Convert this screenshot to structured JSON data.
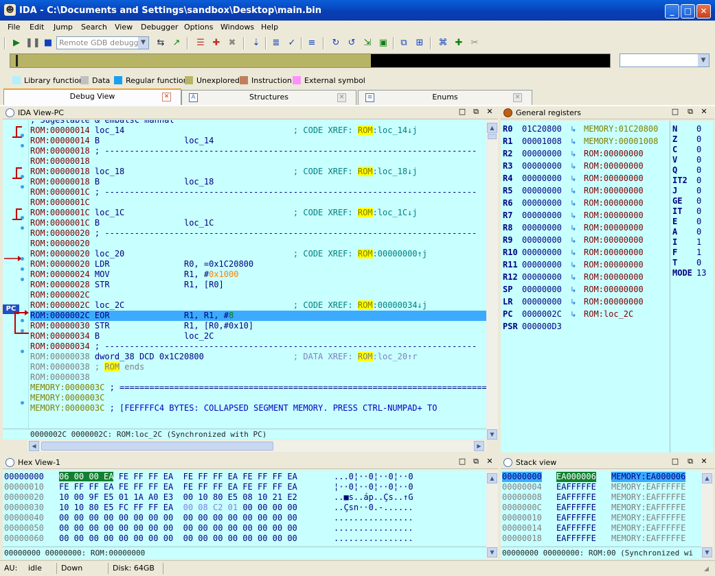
{
  "window": {
    "title": "IDA - C:\\Documents and Settings\\sandbox\\Desktop\\main.bin",
    "minimize": "_",
    "maximize": "□",
    "close": "✕"
  },
  "menu": [
    "File",
    "Edit",
    "Jump",
    "Search",
    "View",
    "Debugger",
    "Options",
    "Windows",
    "Help"
  ],
  "toolbar": {
    "debugger_select": "Remote GDB debugger"
  },
  "legend": [
    {
      "label": "Library function",
      "color": "#b0f0ff"
    },
    {
      "label": "Data",
      "color": "#c0c0c0"
    },
    {
      "label": "Regular function",
      "color": "#1aa0f0"
    },
    {
      "label": "Unexplored",
      "color": "#b8b466"
    },
    {
      "label": "Instruction",
      "color": "#c08060"
    },
    {
      "label": "External symbol",
      "color": "#ff90ff"
    }
  ],
  "tabs": [
    {
      "label": "Debug View",
      "active": true
    },
    {
      "label": "Structures"
    },
    {
      "label": "Enums"
    }
  ],
  "ida_view": {
    "title": "IDA View-PC",
    "lines": [
      [
        [
          "ROM:00000014 ",
          "#800000"
        ],
        [
          "loc_14",
          "#000080"
        ],
        [
          "                                  ; CODE XREF: ",
          "#008080"
        ],
        [
          "ROM",
          "#808000",
          "#ffff00"
        ],
        [
          ":loc_14↓j",
          "#008080"
        ]
      ],
      [
        [
          "ROM:00000014 ",
          "#800000"
        ],
        [
          "B                 ",
          "#000080"
        ],
        [
          "loc_14",
          "#000080"
        ]
      ],
      [
        [
          "ROM:00000018 ",
          "#800000"
        ],
        [
          "; ---------------------------------------------------------------------------",
          "#000080"
        ]
      ],
      [
        [
          "ROM:00000018",
          "#800000"
        ]
      ],
      [
        [
          "ROM:00000018 ",
          "#800000"
        ],
        [
          "loc_18",
          "#000080"
        ],
        [
          "                                  ; CODE XREF: ",
          "#008080"
        ],
        [
          "ROM",
          "#808000",
          "#ffff00"
        ],
        [
          ":loc_18↓j",
          "#008080"
        ]
      ],
      [
        [
          "ROM:00000018 ",
          "#800000"
        ],
        [
          "B                 ",
          "#000080"
        ],
        [
          "loc_18",
          "#000080"
        ]
      ],
      [
        [
          "ROM:0000001C ",
          "#800000"
        ],
        [
          "; ---------------------------------------------------------------------------",
          "#000080"
        ]
      ],
      [
        [
          "ROM:0000001C",
          "#800000"
        ]
      ],
      [
        [
          "ROM:0000001C ",
          "#800000"
        ],
        [
          "loc_1C",
          "#000080"
        ],
        [
          "                                  ; CODE XREF: ",
          "#008080"
        ],
        [
          "ROM",
          "#808000",
          "#ffff00"
        ],
        [
          ":loc_1C↓j",
          "#008080"
        ]
      ],
      [
        [
          "ROM:0000001C ",
          "#800000"
        ],
        [
          "B                 ",
          "#000080"
        ],
        [
          "loc_1C",
          "#000080"
        ]
      ],
      [
        [
          "ROM:00000020 ",
          "#800000"
        ],
        [
          "; ---------------------------------------------------------------------------",
          "#000080"
        ]
      ],
      [
        [
          "ROM:00000020",
          "#800000"
        ]
      ],
      [
        [
          "ROM:00000020 ",
          "#800000"
        ],
        [
          "loc_20",
          "#000080"
        ],
        [
          "                                  ; CODE XREF: ",
          "#008080"
        ],
        [
          "ROM",
          "#808000",
          "#ffff00"
        ],
        [
          ":00000000↑j",
          "#008080"
        ]
      ],
      [
        [
          "ROM:00000020 ",
          "#800000"
        ],
        [
          "LDR               ",
          "#000080"
        ],
        [
          "R0, =0x1C20800",
          "#000080"
        ]
      ],
      [
        [
          "ROM:00000024 ",
          "#800000"
        ],
        [
          "MOV               ",
          "#000080"
        ],
        [
          "R1, #",
          "#000080"
        ],
        [
          "0x1000",
          "#ff8000"
        ]
      ],
      [
        [
          "ROM:00000028 ",
          "#800000"
        ],
        [
          "STR               ",
          "#000080"
        ],
        [
          "R1, [R0]",
          "#000080"
        ]
      ],
      [
        [
          "ROM:0000002C",
          "#800000"
        ]
      ],
      [
        [
          "ROM:0000002C ",
          "#800000"
        ],
        [
          "loc_2C",
          "#000080"
        ],
        [
          "                                  ; CODE XREF: ",
          "#008080"
        ],
        [
          "ROM",
          "#808000",
          "#ffff00"
        ],
        [
          ":00000034↓j",
          "#008080"
        ]
      ],
      [
        [
          "ROM:0000002C ",
          "#000080"
        ],
        [
          "EOR               ",
          "#000080"
        ],
        [
          "R1, R1, #",
          "#000080"
        ],
        [
          "8",
          "#008000"
        ]
      ],
      [
        [
          "ROM:00000030 ",
          "#800000"
        ],
        [
          "STR               ",
          "#000080"
        ],
        [
          "R1, [R0,#0x10]",
          "#000080"
        ]
      ],
      [
        [
          "ROM:00000034 ",
          "#800000"
        ],
        [
          "B                 ",
          "#000080"
        ],
        [
          "loc_2C",
          "#000080"
        ]
      ],
      [
        [
          "ROM:00000034 ",
          "#800000"
        ],
        [
          "; ---------------------------------------------------------------------------",
          "#000080"
        ]
      ],
      [
        [
          "ROM:00000038 ",
          "#808080"
        ],
        [
          "dword_38 DCD 0x1C20800",
          "#000080"
        ],
        [
          "                  ; DATA XREF: ",
          "#8080c0"
        ],
        [
          "ROM",
          "#808080",
          "#ffff00"
        ],
        [
          ":loc_20↑r",
          "#8080c0"
        ]
      ],
      [
        [
          "ROM:00000038 ",
          "#808080"
        ],
        [
          "; ",
          "#808080"
        ],
        [
          "ROM",
          "#808080",
          "#ffff00"
        ],
        [
          " ends",
          "#808080"
        ]
      ],
      [
        [
          "ROM:00000038",
          "#808080"
        ]
      ],
      [
        [
          "MEMORY:0000003C ",
          "#808000"
        ],
        [
          "; ===========================================================================",
          "#000080"
        ]
      ],
      [
        [
          "MEMORY:0000003C",
          "#808000"
        ]
      ],
      [
        [
          "MEMORY:0000003C ",
          "#808000"
        ],
        [
          "; [FEFFFFC4 BYTES: COLLAPSED SEGMENT MEMORY. PRESS CTRL-NUMPAD+ TO",
          "#0000c0"
        ]
      ]
    ],
    "partial_top_line": "; Sugestable & embalsc mannal",
    "status": "0000002C 0000002C: ROM:loc_2C (Synchronized with PC)",
    "pc_label": "PC"
  },
  "registers": {
    "title": "General registers",
    "rows": [
      {
        "name": "R0",
        "value": "01C20800",
        "ref": "MEMORY:01C20800",
        "mem": true
      },
      {
        "name": "R1",
        "value": "00001008",
        "ref": "MEMORY:00001008",
        "mem": true
      },
      {
        "name": "R2",
        "value": "00000000",
        "ref": "ROM:00000000"
      },
      {
        "name": "R3",
        "value": "00000000",
        "ref": "ROM:00000000"
      },
      {
        "name": "R4",
        "value": "00000000",
        "ref": "ROM:00000000"
      },
      {
        "name": "R5",
        "value": "00000000",
        "ref": "ROM:00000000"
      },
      {
        "name": "R6",
        "value": "00000000",
        "ref": "ROM:00000000"
      },
      {
        "name": "R7",
        "value": "00000000",
        "ref": "ROM:00000000"
      },
      {
        "name": "R8",
        "value": "00000000",
        "ref": "ROM:00000000"
      },
      {
        "name": "R9",
        "value": "00000000",
        "ref": "ROM:00000000"
      },
      {
        "name": "R10",
        "value": "00000000",
        "ref": "ROM:00000000"
      },
      {
        "name": "R11",
        "value": "00000000",
        "ref": "ROM:00000000"
      },
      {
        "name": "R12",
        "value": "00000000",
        "ref": "ROM:00000000"
      },
      {
        "name": "SP",
        "value": "00000000",
        "ref": "ROM:00000000"
      },
      {
        "name": "LR",
        "value": "00000000",
        "ref": "ROM:00000000"
      },
      {
        "name": "PC",
        "value": "0000002C",
        "ref": "ROM:loc_2C"
      },
      {
        "name": "PSR",
        "value": "000000D3",
        "ref": ""
      }
    ],
    "flags": [
      [
        "N",
        "0"
      ],
      [
        "Z",
        "0"
      ],
      [
        "C",
        "0"
      ],
      [
        "V",
        "0"
      ],
      [
        "Q",
        "0"
      ],
      [
        "IT2",
        "0"
      ],
      [
        "J",
        "0"
      ],
      [
        "GE",
        "0"
      ],
      [
        "IT",
        "0"
      ],
      [
        "E",
        "0"
      ],
      [
        "A",
        "0"
      ],
      [
        "I",
        "1"
      ],
      [
        "F",
        "1"
      ],
      [
        "T",
        "0"
      ],
      [
        "MODE",
        "13"
      ]
    ]
  },
  "hex_view": {
    "title": "Hex View-1",
    "rows": [
      {
        "addr": "00000000",
        "bytes": "06 00 00 EA FE FF FF EA  FE FF FF EA FE FF FF EA",
        "ascii": "...0¦··0¦··0¦··0"
      },
      {
        "addr": "00000010",
        "bytes": "FE FF FF EA FE FF FF EA  FE FF FF EA FE FF FF EA",
        "ascii": "¦··0¦··0¦··0¦··0"
      },
      {
        "addr": "00000020",
        "bytes": "10 00 9F E5 01 1A A0 E3  00 10 80 E5 08 10 21 E2",
        "ascii": "..■s..áp..Çs..↑G"
      },
      {
        "addr": "00000030",
        "bytes": "10 10 80 E5 FC FF FF EA  00 08 C2 01 00 00 00 00",
        "ascii": "..Çsn··0.-......"
      },
      {
        "addr": "00000040",
        "bytes": "00 00 00 00 00 00 00 00  00 00 00 00 00 00 00 00",
        "ascii": "................"
      },
      {
        "addr": "00000050",
        "bytes": "00 00 00 00 00 00 00 00  00 00 00 00 00 00 00 00",
        "ascii": "................"
      },
      {
        "addr": "00000060",
        "bytes": "00 00 00 00 00 00 00 00  00 00 00 00 00 00 00 00",
        "ascii": "................"
      }
    ],
    "status": "00000000 00000000: ROM:00000000"
  },
  "stack_view": {
    "title": "Stack view",
    "rows": [
      {
        "addr": "00000000",
        "value": "EA000006",
        "ref": "MEMORY:EA000006"
      },
      {
        "addr": "00000004",
        "value": "EAFFFFFE",
        "ref": "MEMORY:EAFFFFFE"
      },
      {
        "addr": "00000008",
        "value": "EAFFFFFE",
        "ref": "MEMORY:EAFFFFFE"
      },
      {
        "addr": "0000000C",
        "value": "EAFFFFFE",
        "ref": "MEMORY:EAFFFFFE"
      },
      {
        "addr": "00000010",
        "value": "EAFFFFFE",
        "ref": "MEMORY:EAFFFFFE"
      },
      {
        "addr": "00000014",
        "value": "EAFFFFFE",
        "ref": "MEMORY:EAFFFFFE"
      },
      {
        "addr": "00000018",
        "value": "EAFFFFFE",
        "ref": "MEMORY:EAFFFFFE"
      }
    ],
    "status": "00000000 00000000: ROM:00 (Synchronized wi"
  },
  "statusbar": {
    "au": "AU:",
    "state": "idle",
    "direction": "Down",
    "disk": "Disk: 64GB"
  }
}
